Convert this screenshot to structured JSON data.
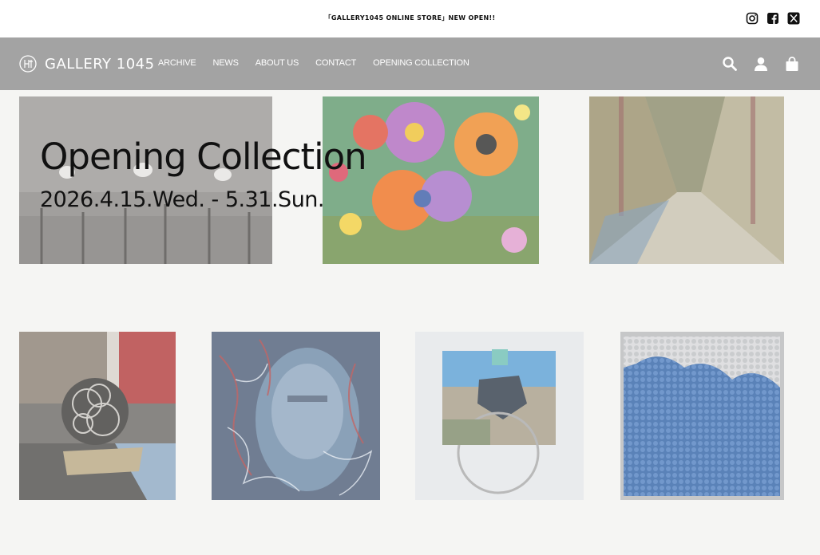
{
  "announcement": "「GALLERY1045 ONLINE STORE」NEW OPEN!!",
  "brand": {
    "name": "GALLERY 1045"
  },
  "nav": {
    "items": [
      "ARCHIVE",
      "NEWS",
      "ABOUT US",
      "CONTACT",
      "OPENING COLLECTION"
    ]
  },
  "social_icons": [
    "instagram-icon",
    "facebook-icon",
    "x-icon"
  ],
  "header_icons": [
    "search-icon",
    "account-icon",
    "cart-icon"
  ],
  "hero": {
    "title": "Opening Collection",
    "dates": "2026.4.15.Wed. - 5.31.Sun."
  },
  "colors": {
    "topbar": "#ffffff",
    "navbar": "#a3a3a3",
    "page": "#f5f5f3",
    "text": "#111111"
  }
}
